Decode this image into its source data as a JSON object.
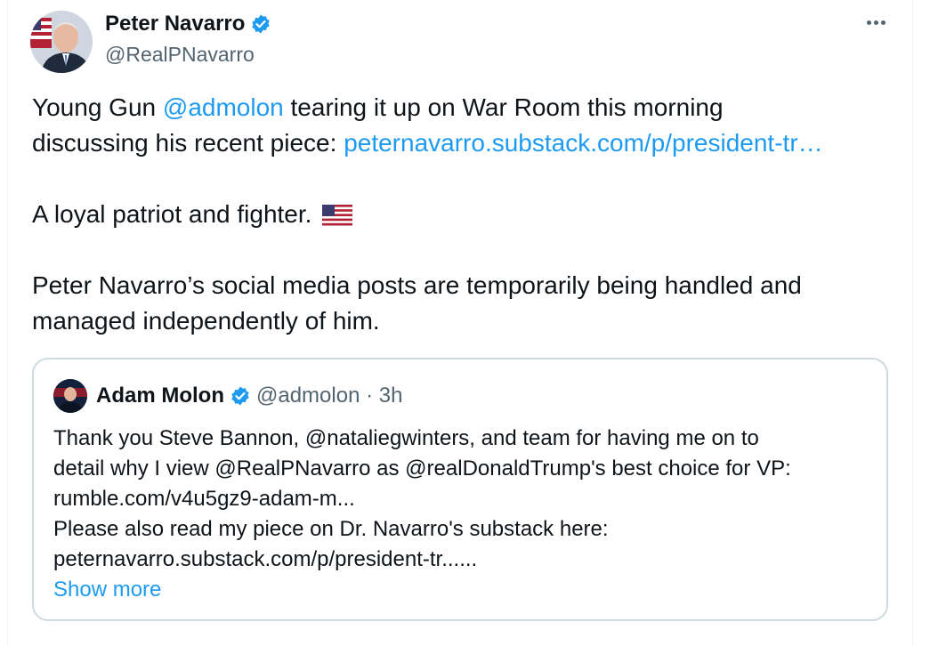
{
  "author": {
    "name": "Peter Navarro",
    "handle": "@RealPNavarro",
    "verified_icon": "verified-badge-icon",
    "avatar_icon": "avatar-photo"
  },
  "post": {
    "line1_pre": "Young Gun ",
    "mention": "@admolon",
    "line1_post": "  tearing it up on War Room this morning",
    "line2_pre": "discussing his recent piece: ",
    "link": "peternavarro.substack.com/p/president-tr…",
    "line3": "A loyal patriot and fighter.",
    "line3_emoji": "us-flag-emoji",
    "line4": "Peter Navarro’s social media posts are temporarily being handled and",
    "line5": "managed independently of him."
  },
  "quoted": {
    "name": "Adam Molon",
    "meta": "@admolon · 3h",
    "lines": [
      "Thank you Steve Bannon, @nataliegwinters, and team for having me on to",
      "detail why I view @RealPNavarro as @realDonaldTrump's best choice for VP:",
      "rumble.com/v4u5gz9-adam-m...",
      "Please also read my piece on Dr. Navarro's substack here:",
      "peternavarro.substack.com/p/president-tr......"
    ],
    "show_more": "Show more"
  },
  "colors": {
    "link": "#1d9bf0",
    "verified": "#1d9bf0",
    "secondary_text": "#536471",
    "border": "#cfd9de"
  }
}
